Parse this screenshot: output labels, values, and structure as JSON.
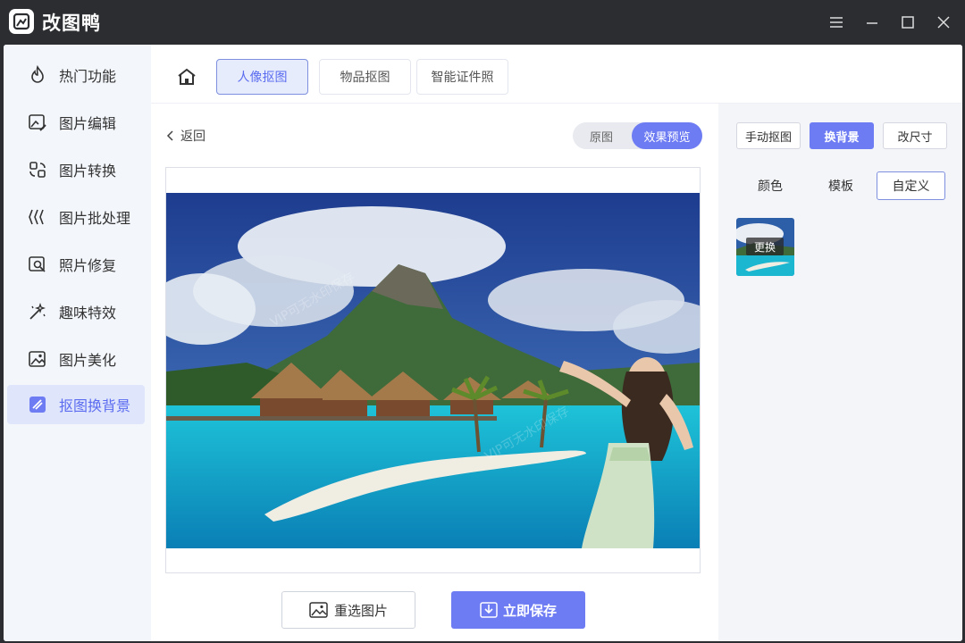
{
  "app": {
    "title": "改图鸭"
  },
  "sidebar": {
    "items": [
      {
        "label": "热门功能",
        "icon": "flame-icon"
      },
      {
        "label": "图片编辑",
        "icon": "image-edit-icon"
      },
      {
        "label": "图片转换",
        "icon": "convert-icon"
      },
      {
        "label": "图片批处理",
        "icon": "batch-icon"
      },
      {
        "label": "照片修复",
        "icon": "photo-repair-icon"
      },
      {
        "label": "趣味特效",
        "icon": "magic-wand-icon"
      },
      {
        "label": "图片美化",
        "icon": "beautify-icon"
      },
      {
        "label": "抠图换背景",
        "icon": "cutout-icon",
        "active": true
      }
    ]
  },
  "tabs": [
    {
      "label": "人像抠图",
      "active": true
    },
    {
      "label": "物品抠图"
    },
    {
      "label": "智能证件照"
    }
  ],
  "main": {
    "back_label": "返回",
    "view_toggle": {
      "original": "原图",
      "preview": "效果预览",
      "selected": "效果预览"
    },
    "reselect_label": "重选图片",
    "save_label": "立即保存"
  },
  "right_panel": {
    "modes": [
      {
        "label": "手动抠图"
      },
      {
        "label": "换背景",
        "active": true
      },
      {
        "label": "改尺寸"
      }
    ],
    "subtabs": [
      {
        "label": "颜色"
      },
      {
        "label": "模板"
      },
      {
        "label": "自定义",
        "active": true
      }
    ],
    "thumbnail": {
      "badge": "更换"
    }
  },
  "colors": {
    "accent": "#6e7cf3",
    "titlebar": "#2b2d30",
    "sidebar_bg": "#f3f6fb",
    "panel_bg": "#f4f5f9"
  }
}
